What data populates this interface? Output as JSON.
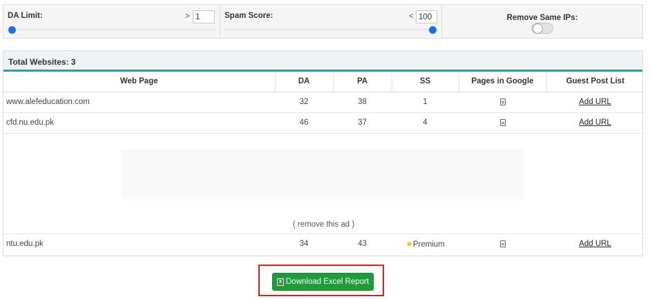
{
  "filters": {
    "da": {
      "label": "DA Limit:",
      "comparator": ">",
      "value": "1",
      "slider_fraction": 0.0
    },
    "ss": {
      "label": "Spam Score:",
      "comparator": "<",
      "value": "100",
      "slider_fraction": 1.0
    },
    "ip": {
      "label": "Remove Same IPs:",
      "enabled": false
    }
  },
  "table": {
    "total_label": "Total Websites: 3",
    "headers": [
      "Web Page",
      "DA",
      "PA",
      "SS",
      "Pages in Google",
      "Guest Post List"
    ],
    "rows": [
      {
        "web_page": "www.alefeducation.com",
        "da": "32",
        "pa": "38",
        "ss": "1",
        "pages_icon": "document-icon",
        "guest": "Add URL"
      },
      {
        "web_page": "cfd.nu.edu.pk",
        "da": "46",
        "pa": "37",
        "ss": "4",
        "pages_icon": "document-icon",
        "guest": "Add URL"
      },
      {
        "web_page": "ntu.edu.pk",
        "da": "34",
        "pa": "43",
        "ss": "Premium",
        "ss_icon": "star-icon",
        "pages_icon": "document-icon",
        "guest": "Add URL"
      }
    ],
    "ad": {
      "remove_label": "( remove this ad )"
    }
  },
  "download": {
    "label": "Download Excel Report",
    "icon": "excel-icon"
  },
  "colors": {
    "accent": "#1aa0b8",
    "slider": "#1a73e8",
    "button": "#1e9c3a",
    "highlight": "#d91c1c"
  }
}
